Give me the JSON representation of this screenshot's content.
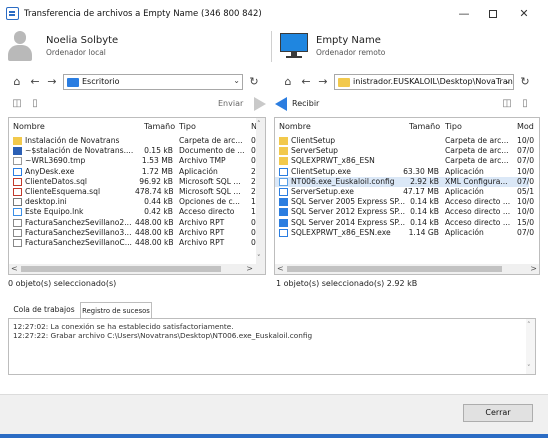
{
  "window": {
    "title": "Transferencia de archivos a Empty Name (346 800 842)",
    "minimize": "—",
    "close": "✕"
  },
  "local": {
    "name": "Noelia Solbyte",
    "subtitle": "Ordenador local",
    "path": "Escritorio",
    "back": "←",
    "forward": "→",
    "home": "⌂",
    "refresh": "↻",
    "dropdown": "⌄"
  },
  "remote": {
    "name": "Empty Name",
    "subtitle": "Ordenador remoto",
    "path": "inistrador.EUSKALOIL\\Desktop\\NovaTrans",
    "back": "←",
    "forward": "→",
    "home": "⌂",
    "refresh": "↻",
    "dropdown": "⌄"
  },
  "actions": {
    "send": "Enviar",
    "receive": "Recibir"
  },
  "left_columns": [
    "Nombre",
    "Tamaño",
    "Tipo",
    "N"
  ],
  "left_files": [
    {
      "name": "Instalación de Novatrans",
      "size": "",
      "type": "Carpeta de arc...",
      "extra": "0",
      "icon": "folder"
    },
    {
      "name": "~$stalación de Novatrans....",
      "size": "0.15 kB",
      "type": "Documento de ...",
      "extra": "0",
      "icon": "doc"
    },
    {
      "name": "~WRL3690.tmp",
      "size": "1.53 MB",
      "type": "Archivo TMP",
      "extra": "0",
      "icon": "file"
    },
    {
      "name": "AnyDesk.exe",
      "size": "1.72 MB",
      "type": "Aplicación",
      "extra": "2",
      "icon": "app"
    },
    {
      "name": "ClienteDatos.sql",
      "size": "96.92 kB",
      "type": "Microsoft SQL ...",
      "extra": "2",
      "icon": "sql"
    },
    {
      "name": "ClienteEsquema.sql",
      "size": "478.74 kB",
      "type": "Microsoft SQL ...",
      "extra": "2",
      "icon": "sql"
    },
    {
      "name": "desktop.ini",
      "size": "0.44 kB",
      "type": "Opciones de c...",
      "extra": "1",
      "icon": "ini"
    },
    {
      "name": "Este Equipo.lnk",
      "size": "0.42 kB",
      "type": "Acceso directo",
      "extra": "1",
      "icon": "lnk"
    },
    {
      "name": "FacturaSanchezSevillano2...",
      "size": "448.00 kB",
      "type": "Archivo RPT",
      "extra": "0",
      "icon": "rpt"
    },
    {
      "name": "FacturaSanchezSevillano3...",
      "size": "448.00 kB",
      "type": "Archivo RPT",
      "extra": "0",
      "icon": "rpt"
    },
    {
      "name": "FacturaSanchezSevillanoC...",
      "size": "448.00 kB",
      "type": "Archivo RPT",
      "extra": "0",
      "icon": "rpt"
    }
  ],
  "right_columns": [
    "Nombre",
    "Tamaño",
    "Tipo",
    "Mod"
  ],
  "right_files": [
    {
      "name": "ClientSetup",
      "size": "",
      "type": "Carpeta de arc...",
      "extra": "10/0",
      "icon": "folder"
    },
    {
      "name": "ServerSetup",
      "size": "",
      "type": "Carpeta de arc...",
      "extra": "07/0",
      "icon": "folder"
    },
    {
      "name": "SQLEXPRWT_x86_ESN",
      "size": "",
      "type": "Carpeta de arc...",
      "extra": "07/0",
      "icon": "folder"
    },
    {
      "name": "ClientSetup.exe",
      "size": "63.30 MB",
      "type": "Aplicación",
      "extra": "10/0",
      "icon": "app"
    },
    {
      "name": "NT006.exe_Euskaloil.config",
      "size": "2.92 kB",
      "type": "XML Configura...",
      "extra": "07/0",
      "icon": "config"
    },
    {
      "name": "ServerSetup.exe",
      "size": "47.17 MB",
      "type": "Aplicación",
      "extra": "05/1",
      "icon": "app"
    },
    {
      "name": "SQL Server 2005 Express SP...",
      "size": "0.14 kB",
      "type": "Acceso directo ...",
      "extra": "10/0",
      "icon": "sqlserver"
    },
    {
      "name": "SQL Server 2012 Express SP...",
      "size": "0.14 kB",
      "type": "Acceso directo ...",
      "extra": "10/0",
      "icon": "sqlserver"
    },
    {
      "name": "SQL Server 2014 Express SP...",
      "size": "0.14 kB",
      "type": "Acceso directo ...",
      "extra": "15/0",
      "icon": "sqlserver"
    },
    {
      "name": "SQLEXPRWT_x86_ESN.exe",
      "size": "1.14 GB",
      "type": "Aplicación",
      "extra": "07/0",
      "icon": "app"
    }
  ],
  "status": {
    "left": "0 objeto(s) seleccionado(s)",
    "right": "1 objeto(s) seleccionado(s)  2.92 kB"
  },
  "tabs": {
    "queue": "Cola de trabajos",
    "log": "Registro de sucesos"
  },
  "log": [
    "12:27:02: La conexión se ha establecido satisfactoriamente.",
    "12:27:22: Grabar archivo C:\\Users\\Novatrans\\Desktop\\NT006.exe_Euskaloil.config"
  ],
  "footer": {
    "close_button": "Cerrar"
  },
  "colors": {
    "accent": "#2b7de0",
    "folder": "#f2c94c",
    "selection": "#dbe8f7",
    "monitor": "#1f86e0"
  }
}
